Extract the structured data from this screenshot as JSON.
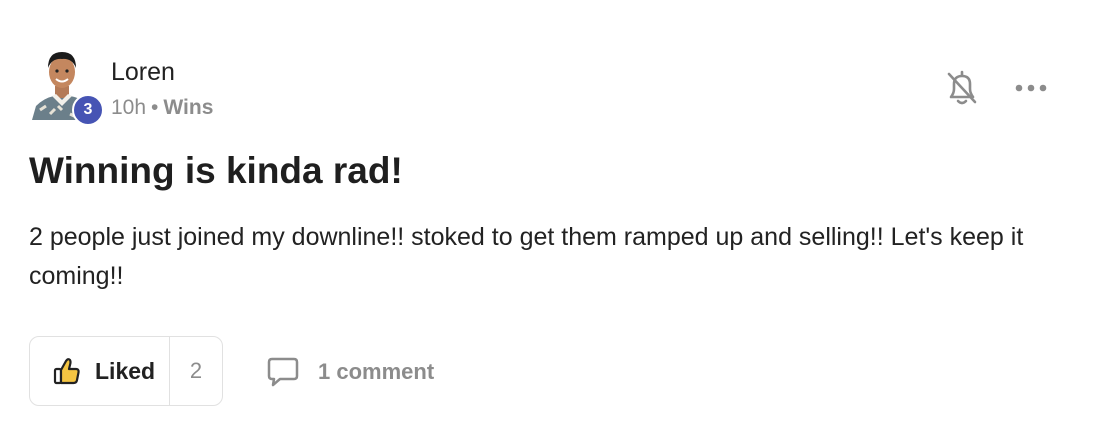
{
  "post": {
    "author": "Loren",
    "level": "3",
    "time": "10h",
    "separator": "•",
    "category": "Wins",
    "title": "Winning is kinda rad!",
    "body": "2 people just joined my downline!! stoked to get them ramped up and selling!! Let's keep it coming!!"
  },
  "actions": {
    "liked_label": "Liked",
    "like_count": "2",
    "comment_label": "1 comment"
  },
  "icons": {
    "bell": "bell-off-icon",
    "more": "more-horizontal-icon",
    "like": "thumbs-up-icon",
    "comment": "comment-bubble-icon"
  },
  "colors": {
    "level_badge": "#4654b4",
    "like_icon_fill": "#f5c542",
    "muted_text": "#8c8c8c"
  }
}
